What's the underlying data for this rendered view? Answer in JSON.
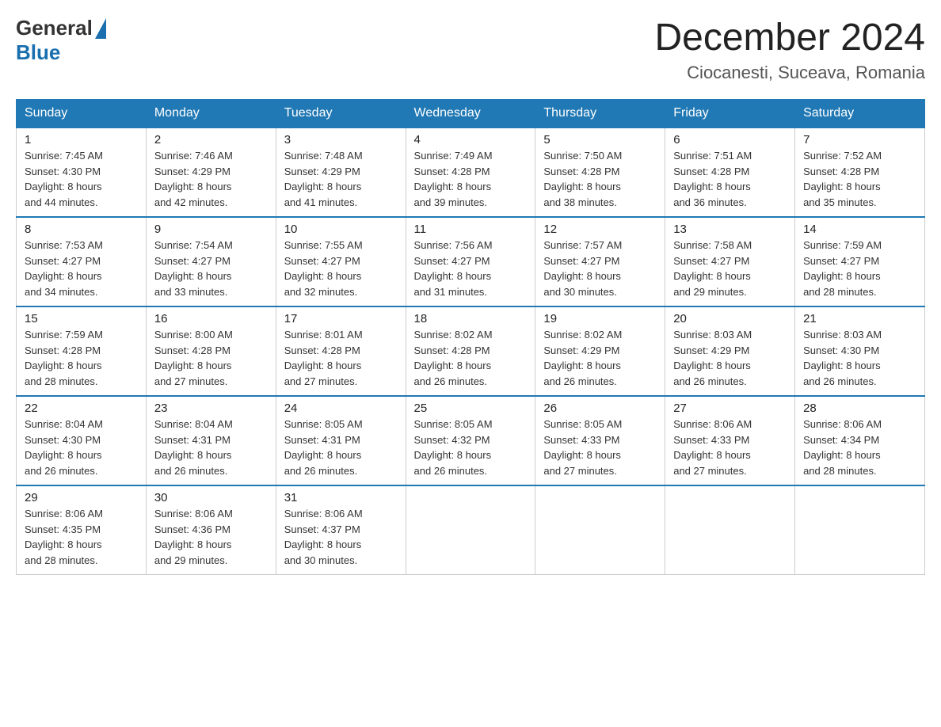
{
  "header": {
    "logo_general": "General",
    "logo_blue": "Blue",
    "month_title": "December 2024",
    "location": "Ciocanesti, Suceava, Romania"
  },
  "weekdays": [
    "Sunday",
    "Monday",
    "Tuesday",
    "Wednesday",
    "Thursday",
    "Friday",
    "Saturday"
  ],
  "weeks": [
    [
      {
        "day": "1",
        "sunrise": "7:45 AM",
        "sunset": "4:30 PM",
        "daylight": "8 hours and 44 minutes."
      },
      {
        "day": "2",
        "sunrise": "7:46 AM",
        "sunset": "4:29 PM",
        "daylight": "8 hours and 42 minutes."
      },
      {
        "day": "3",
        "sunrise": "7:48 AM",
        "sunset": "4:29 PM",
        "daylight": "8 hours and 41 minutes."
      },
      {
        "day": "4",
        "sunrise": "7:49 AM",
        "sunset": "4:28 PM",
        "daylight": "8 hours and 39 minutes."
      },
      {
        "day": "5",
        "sunrise": "7:50 AM",
        "sunset": "4:28 PM",
        "daylight": "8 hours and 38 minutes."
      },
      {
        "day": "6",
        "sunrise": "7:51 AM",
        "sunset": "4:28 PM",
        "daylight": "8 hours and 36 minutes."
      },
      {
        "day": "7",
        "sunrise": "7:52 AM",
        "sunset": "4:28 PM",
        "daylight": "8 hours and 35 minutes."
      }
    ],
    [
      {
        "day": "8",
        "sunrise": "7:53 AM",
        "sunset": "4:27 PM",
        "daylight": "8 hours and 34 minutes."
      },
      {
        "day": "9",
        "sunrise": "7:54 AM",
        "sunset": "4:27 PM",
        "daylight": "8 hours and 33 minutes."
      },
      {
        "day": "10",
        "sunrise": "7:55 AM",
        "sunset": "4:27 PM",
        "daylight": "8 hours and 32 minutes."
      },
      {
        "day": "11",
        "sunrise": "7:56 AM",
        "sunset": "4:27 PM",
        "daylight": "8 hours and 31 minutes."
      },
      {
        "day": "12",
        "sunrise": "7:57 AM",
        "sunset": "4:27 PM",
        "daylight": "8 hours and 30 minutes."
      },
      {
        "day": "13",
        "sunrise": "7:58 AM",
        "sunset": "4:27 PM",
        "daylight": "8 hours and 29 minutes."
      },
      {
        "day": "14",
        "sunrise": "7:59 AM",
        "sunset": "4:27 PM",
        "daylight": "8 hours and 28 minutes."
      }
    ],
    [
      {
        "day": "15",
        "sunrise": "7:59 AM",
        "sunset": "4:28 PM",
        "daylight": "8 hours and 28 minutes."
      },
      {
        "day": "16",
        "sunrise": "8:00 AM",
        "sunset": "4:28 PM",
        "daylight": "8 hours and 27 minutes."
      },
      {
        "day": "17",
        "sunrise": "8:01 AM",
        "sunset": "4:28 PM",
        "daylight": "8 hours and 27 minutes."
      },
      {
        "day": "18",
        "sunrise": "8:02 AM",
        "sunset": "4:28 PM",
        "daylight": "8 hours and 26 minutes."
      },
      {
        "day": "19",
        "sunrise": "8:02 AM",
        "sunset": "4:29 PM",
        "daylight": "8 hours and 26 minutes."
      },
      {
        "day": "20",
        "sunrise": "8:03 AM",
        "sunset": "4:29 PM",
        "daylight": "8 hours and 26 minutes."
      },
      {
        "day": "21",
        "sunrise": "8:03 AM",
        "sunset": "4:30 PM",
        "daylight": "8 hours and 26 minutes."
      }
    ],
    [
      {
        "day": "22",
        "sunrise": "8:04 AM",
        "sunset": "4:30 PM",
        "daylight": "8 hours and 26 minutes."
      },
      {
        "day": "23",
        "sunrise": "8:04 AM",
        "sunset": "4:31 PM",
        "daylight": "8 hours and 26 minutes."
      },
      {
        "day": "24",
        "sunrise": "8:05 AM",
        "sunset": "4:31 PM",
        "daylight": "8 hours and 26 minutes."
      },
      {
        "day": "25",
        "sunrise": "8:05 AM",
        "sunset": "4:32 PM",
        "daylight": "8 hours and 26 minutes."
      },
      {
        "day": "26",
        "sunrise": "8:05 AM",
        "sunset": "4:33 PM",
        "daylight": "8 hours and 27 minutes."
      },
      {
        "day": "27",
        "sunrise": "8:06 AM",
        "sunset": "4:33 PM",
        "daylight": "8 hours and 27 minutes."
      },
      {
        "day": "28",
        "sunrise": "8:06 AM",
        "sunset": "4:34 PM",
        "daylight": "8 hours and 28 minutes."
      }
    ],
    [
      {
        "day": "29",
        "sunrise": "8:06 AM",
        "sunset": "4:35 PM",
        "daylight": "8 hours and 28 minutes."
      },
      {
        "day": "30",
        "sunrise": "8:06 AM",
        "sunset": "4:36 PM",
        "daylight": "8 hours and 29 minutes."
      },
      {
        "day": "31",
        "sunrise": "8:06 AM",
        "sunset": "4:37 PM",
        "daylight": "8 hours and 30 minutes."
      },
      null,
      null,
      null,
      null
    ]
  ],
  "labels": {
    "sunrise": "Sunrise:",
    "sunset": "Sunset:",
    "daylight": "Daylight:"
  }
}
